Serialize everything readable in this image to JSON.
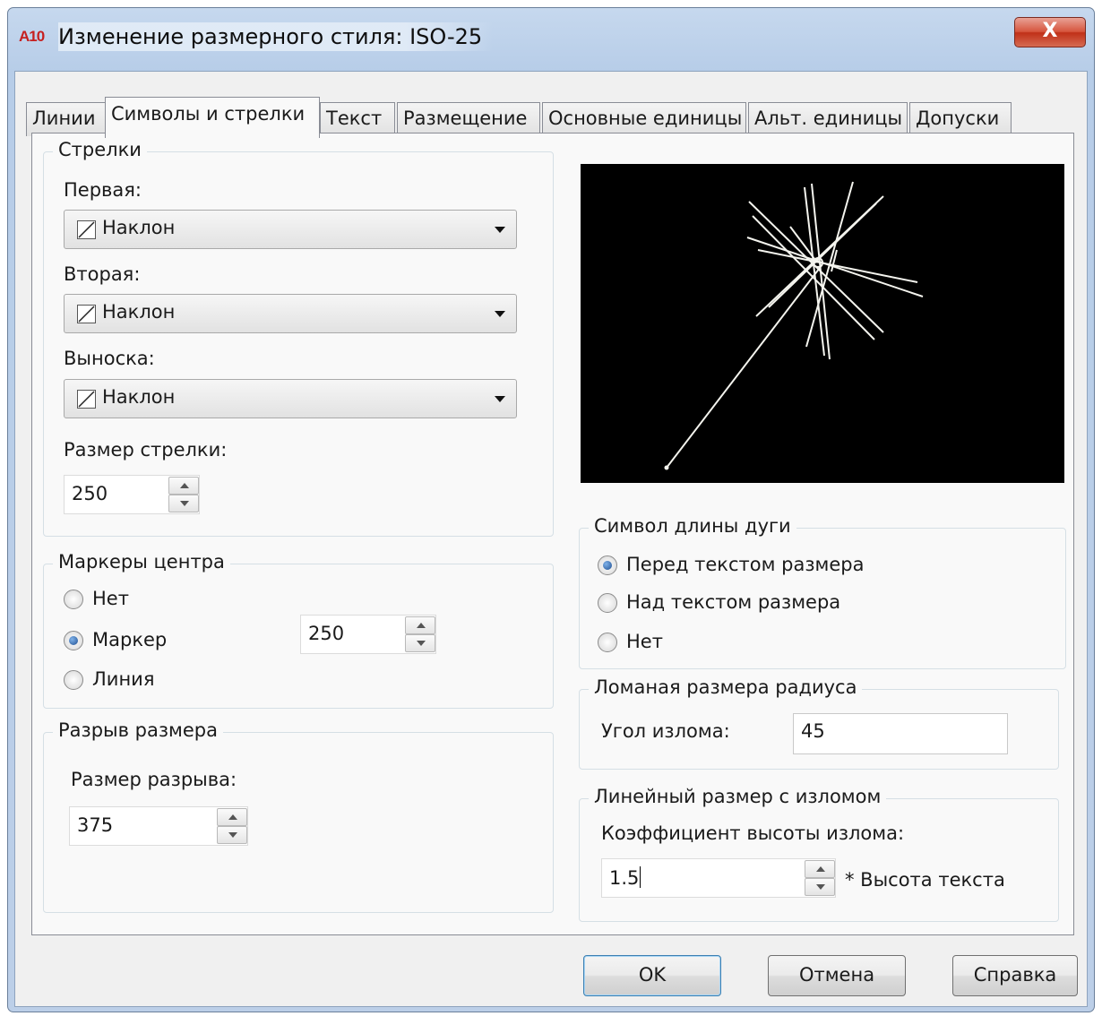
{
  "window": {
    "title": "Изменение размерного стиля: ISO-25",
    "app_icon_text": "A10",
    "close_glyph": "X"
  },
  "tabs": [
    {
      "label": "Линии"
    },
    {
      "label": "Символы и стрелки"
    },
    {
      "label": "Текст"
    },
    {
      "label": "Размещение"
    },
    {
      "label": "Основные единицы"
    },
    {
      "label": "Альт. единицы"
    },
    {
      "label": "Допуски"
    }
  ],
  "active_tab": "Символы и стрелки",
  "arrows": {
    "group_title": "Стрелки",
    "first_label": "Первая:",
    "first_value": "Наклон",
    "second_label": "Вторая:",
    "second_value": "Наклон",
    "leader_label": "Выноска:",
    "leader_value": "Наклон",
    "size_label": "Размер стрелки:",
    "size_value": "250"
  },
  "center_marks": {
    "group_title": "Маркеры центра",
    "options": [
      "Нет",
      "Маркер",
      "Линия"
    ],
    "selected": "Маркер",
    "size_value": "250"
  },
  "dim_break": {
    "group_title": "Разрыв размера",
    "size_label": "Размер разрыва:",
    "size_value": "375"
  },
  "arc_length": {
    "group_title": "Символ длины дуги",
    "options": [
      "Перед текстом размера",
      "Над текстом размера",
      "Нет"
    ],
    "selected": "Перед текстом размера"
  },
  "radius_jog": {
    "group_title": "Ломаная размера радиуса",
    "angle_label": "Угол излома:",
    "angle_value": "45"
  },
  "linear_jog": {
    "group_title": "Линейный размер с изломом",
    "factor_label": "Коэффициент высоты излома:",
    "factor_value": "1.5",
    "factor_suffix": "* Высота текста"
  },
  "buttons": {
    "ok": "OK",
    "cancel": "Отмена",
    "help": "Справка"
  },
  "colors": {
    "preview_bg": "#000000",
    "preview_lines": "#ffffff",
    "title_bar": "#b9d1ea"
  }
}
